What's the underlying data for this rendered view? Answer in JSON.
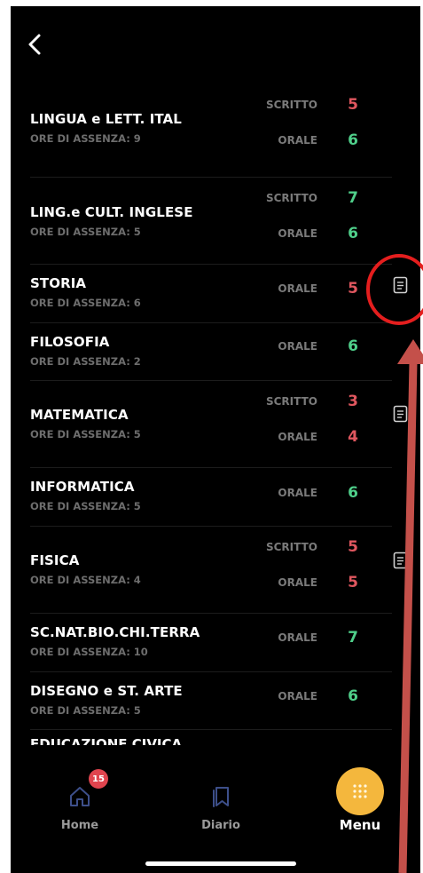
{
  "colors": {
    "background": "#000000",
    "grade_fail": "#e0575f",
    "grade_pass": "#4fcf8a",
    "accent": "#f4b73d",
    "badge": "#e0444e",
    "annotation": "#c4504a"
  },
  "header": {
    "back_icon": "chevron-left-icon"
  },
  "subjects": [
    {
      "name": "LINGUA e LETT. ITAL",
      "absence": "ORE DI ASSENZA: 9",
      "grades": [
        {
          "type": "SCRITTO",
          "value": "5",
          "status": "fail"
        },
        {
          "type": "ORALE",
          "value": "6",
          "status": "pass"
        }
      ],
      "has_note": false
    },
    {
      "name": "LING.e CULT. INGLESE",
      "absence": "ORE DI ASSENZA: 5",
      "grades": [
        {
          "type": "SCRITTO",
          "value": "7",
          "status": "pass"
        },
        {
          "type": "ORALE",
          "value": "6",
          "status": "pass"
        }
      ],
      "has_note": false
    },
    {
      "name": "STORIA",
      "absence": "ORE DI ASSENZA: 6",
      "grades": [
        {
          "type": "ORALE",
          "value": "5",
          "status": "fail"
        }
      ],
      "has_note": true
    },
    {
      "name": "FILOSOFIA",
      "absence": "ORE DI ASSENZA: 2",
      "grades": [
        {
          "type": "ORALE",
          "value": "6",
          "status": "pass"
        }
      ],
      "has_note": false
    },
    {
      "name": "MATEMATICA",
      "absence": "ORE DI ASSENZA: 5",
      "grades": [
        {
          "type": "SCRITTO",
          "value": "3",
          "status": "fail"
        },
        {
          "type": "ORALE",
          "value": "4",
          "status": "fail"
        }
      ],
      "has_note": true
    },
    {
      "name": "INFORMATICA",
      "absence": "ORE DI ASSENZA: 5",
      "grades": [
        {
          "type": "ORALE",
          "value": "6",
          "status": "pass"
        }
      ],
      "has_note": false
    },
    {
      "name": "FISICA",
      "absence": "ORE DI ASSENZA: 4",
      "grades": [
        {
          "type": "SCRITTO",
          "value": "5",
          "status": "fail"
        },
        {
          "type": "ORALE",
          "value": "5",
          "status": "fail"
        }
      ],
      "has_note": true
    },
    {
      "name": "SC.NAT.BIO.CHI.TERRA",
      "absence": "ORE DI ASSENZA: 10",
      "grades": [
        {
          "type": "ORALE",
          "value": "7",
          "status": "pass"
        }
      ],
      "has_note": false
    },
    {
      "name": "DISEGNO e ST. ARTE",
      "absence": "ORE DI ASSENZA: 5",
      "grades": [
        {
          "type": "ORALE",
          "value": "6",
          "status": "pass"
        }
      ],
      "has_note": false
    }
  ],
  "partial_subject": "EDUCAZIONE CIVICA",
  "tabbar": {
    "home": {
      "label": "Home",
      "icon": "home-icon",
      "badge": "15"
    },
    "diario": {
      "label": "Diario",
      "icon": "bookmark-icon"
    },
    "menu": {
      "label": "Menu",
      "icon": "grid-dots-icon"
    }
  }
}
